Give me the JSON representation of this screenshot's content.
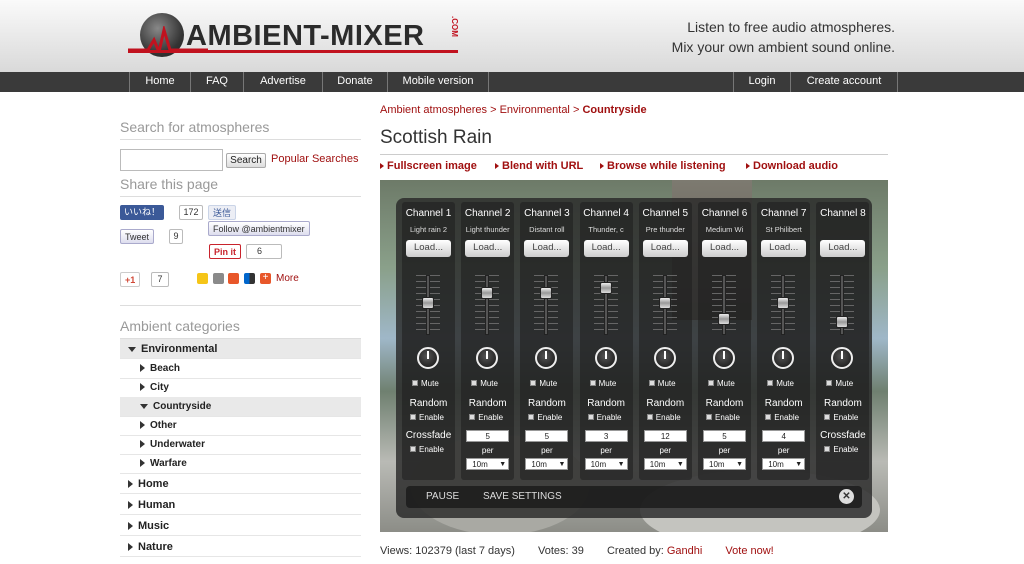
{
  "header": {
    "logo_text": "AMBIENT-MIXER",
    "logo_suffix": ".COM",
    "tagline_1": "Listen to free audio atmospheres.",
    "tagline_2": "Mix your own ambient sound online."
  },
  "nav": {
    "home": "Home",
    "faq": "FAQ",
    "advertise": "Advertise",
    "donate": "Donate",
    "mobile": "Mobile version",
    "login": "Login",
    "create": "Create account"
  },
  "sidebar": {
    "search_heading": "Search for atmospheres",
    "search_value": "",
    "search_button": "Search",
    "popular": "Popular Searches",
    "share_heading": "Share this page",
    "fb_like": "いいね！",
    "fb_like_count": "172",
    "fb_send": "送信",
    "tweet": "Tweet",
    "tweet_count": "9",
    "follow": "Follow @ambientmixer",
    "pin": "Pin it",
    "pin_count": "6",
    "gplus": "+1",
    "gplus_count": "7",
    "more": "More",
    "categories_heading": "Ambient categories",
    "categories": [
      {
        "label": "Environmental"
      },
      {
        "label": "Beach"
      },
      {
        "label": "City"
      },
      {
        "label": "Countryside"
      },
      {
        "label": "Other"
      },
      {
        "label": "Underwater"
      },
      {
        "label": "Warfare"
      },
      {
        "label": "Home"
      },
      {
        "label": "Human"
      },
      {
        "label": "Music"
      },
      {
        "label": "Nature"
      }
    ]
  },
  "main": {
    "breadcrumb_1": "Ambient atmospheres",
    "breadcrumb_2": "Environmental",
    "breadcrumb_3": "Countryside",
    "sep": ">",
    "title": "Scottish Rain",
    "actions": [
      "Fullscreen image",
      "Blend with URL",
      "Browse while listening",
      "Download audio"
    ]
  },
  "mixer": {
    "load_label": "Load...",
    "mute_label": "Mute",
    "random_label": "Random",
    "enable_label": "Enable",
    "crossfade_label": "Crossfade",
    "per_label": "per",
    "pause": "PAUSE",
    "save_settings": "SAVE SETTINGS",
    "channels": [
      {
        "name": "Channel 1",
        "sound": "Light rain 2",
        "volume": 0.55,
        "random": false,
        "num": "",
        "interval": ""
      },
      {
        "name": "Channel 2",
        "sound": "Light thunder",
        "volume": 0.75,
        "random": true,
        "num": "5",
        "interval": "10m"
      },
      {
        "name": "Channel 3",
        "sound": "Distant roll",
        "volume": 0.75,
        "random": true,
        "num": "5",
        "interval": "10m"
      },
      {
        "name": "Channel 4",
        "sound": "Thunder, c",
        "volume": 0.85,
        "random": true,
        "num": "3",
        "interval": "10m"
      },
      {
        "name": "Channel 5",
        "sound": "Pre thunder",
        "volume": 0.55,
        "random": true,
        "num": "12",
        "interval": "10m"
      },
      {
        "name": "Channel 6",
        "sound": "Medium Wi",
        "volume": 0.2,
        "random": true,
        "num": "5",
        "interval": "10m"
      },
      {
        "name": "Channel 7",
        "sound": "St Philibert",
        "volume": 0.55,
        "random": true,
        "num": "4",
        "interval": "10m"
      },
      {
        "name": "Channel 8",
        "sound": "",
        "volume": 0.15,
        "random": false,
        "num": "",
        "interval": ""
      }
    ]
  },
  "stats": {
    "views": "Views: 102379 (last 7 days)",
    "votes": "Votes: 39",
    "created": "Created by:",
    "author": "Gandhi",
    "vote_now": "Vote now!"
  },
  "colors": {
    "accent": "#a01010",
    "nav_bg": "#3a3a3a"
  }
}
